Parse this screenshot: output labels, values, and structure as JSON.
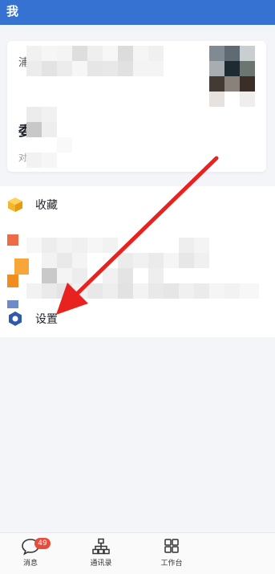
{
  "header": {
    "title": "我"
  },
  "profile": {
    "name_prefix": "浦",
    "big_char": "委",
    "sub_char": "对"
  },
  "menu": {
    "favorites": {
      "label": "收藏",
      "icon": "cube-icon"
    },
    "settings": {
      "label": "设置",
      "icon": "hexagon-gear-icon"
    }
  },
  "tabbar": {
    "messages": {
      "label": "消息",
      "badge": "49",
      "icon": "chat-bubble-icon"
    },
    "contacts": {
      "label": "通讯录",
      "icon": "org-chart-icon"
    },
    "workbench": {
      "label": "工作台",
      "icon": "grid-icon"
    }
  },
  "colors": {
    "header": "#3672d1",
    "arrow": "#e8231f",
    "badge": "#e84c3d",
    "cube": "#f5b62f",
    "settings_icon": "#2f5aa8"
  }
}
